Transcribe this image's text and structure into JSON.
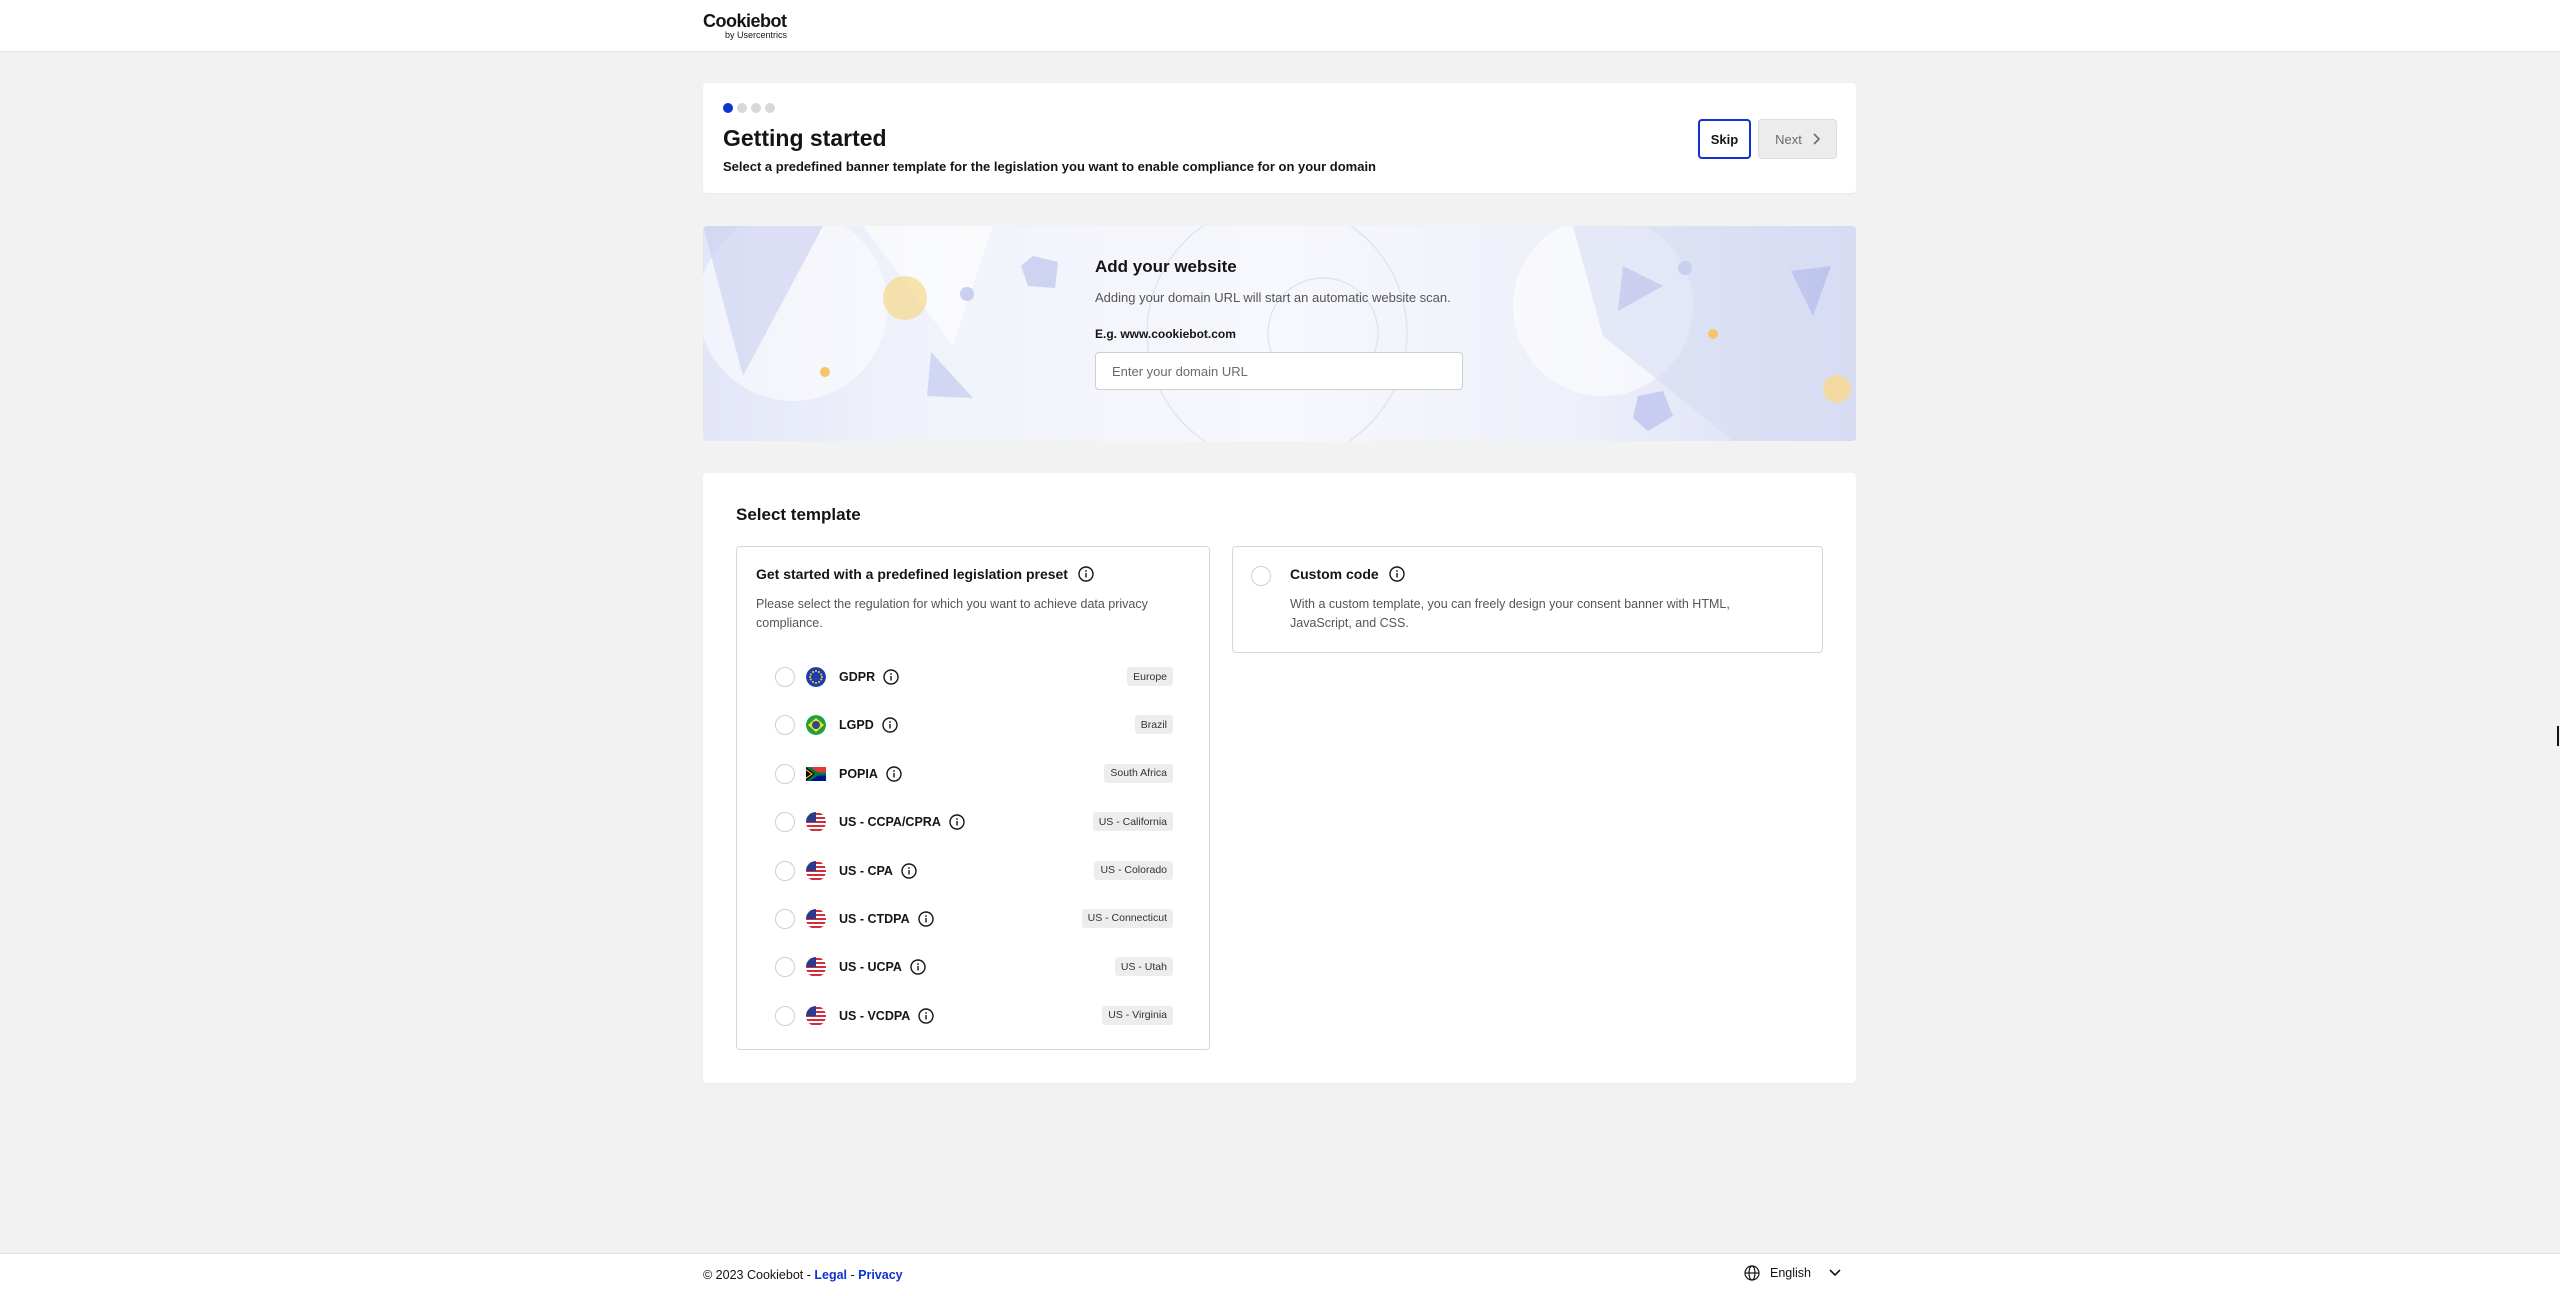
{
  "header": {
    "logo_text": "Cookiebot",
    "logo_sub": "by Usercentrics"
  },
  "getting_started": {
    "steps_total": 4,
    "active_step": 1,
    "title": "Getting started",
    "subtitle": "Select a predefined banner template for the legislation you want to enable compliance for on your domain",
    "skip_label": "Skip",
    "next_label": "Next"
  },
  "add_website": {
    "title": "Add your website",
    "description": "Adding your domain URL will start an automatic website scan.",
    "field_label": "E.g. www.cookiebot.com",
    "placeholder": "Enter your domain URL",
    "value": ""
  },
  "select_template": {
    "title": "Select template",
    "preset": {
      "title": "Get started with a predefined legislation preset",
      "description": "Please select the regulation for which you want to achieve data privacy compliance.",
      "regulations": [
        {
          "name": "GDPR",
          "region": "Europe",
          "flag": "eu-flag-icon"
        },
        {
          "name": "LGPD",
          "region": "Brazil",
          "flag": "brazil-flag-icon"
        },
        {
          "name": "POPIA",
          "region": "South Africa",
          "flag": "south-africa-flag-icon"
        },
        {
          "name": "US - CCPA/CPRA",
          "region": "US - California",
          "flag": "us-flag-icon"
        },
        {
          "name": "US - CPA",
          "region": "US - Colorado",
          "flag": "us-flag-icon"
        },
        {
          "name": "US - CTDPA",
          "region": "US - Connecticut",
          "flag": "us-flag-icon"
        },
        {
          "name": "US - UCPA",
          "region": "US - Utah",
          "flag": "us-flag-icon"
        },
        {
          "name": "US - VCDPA",
          "region": "US - Virginia",
          "flag": "us-flag-icon"
        }
      ]
    },
    "custom": {
      "title": "Custom code",
      "description": "With a custom template, you can freely design your consent banner with HTML, JavaScript, and CSS."
    }
  },
  "footer": {
    "copyright": "© 2023 Cookiebot - ",
    "legal_label": "Legal",
    "separator": " - ",
    "privacy_label": "Privacy",
    "language": "English"
  },
  "colors": {
    "accent": "#1032cf",
    "background": "#f2f2f2"
  }
}
